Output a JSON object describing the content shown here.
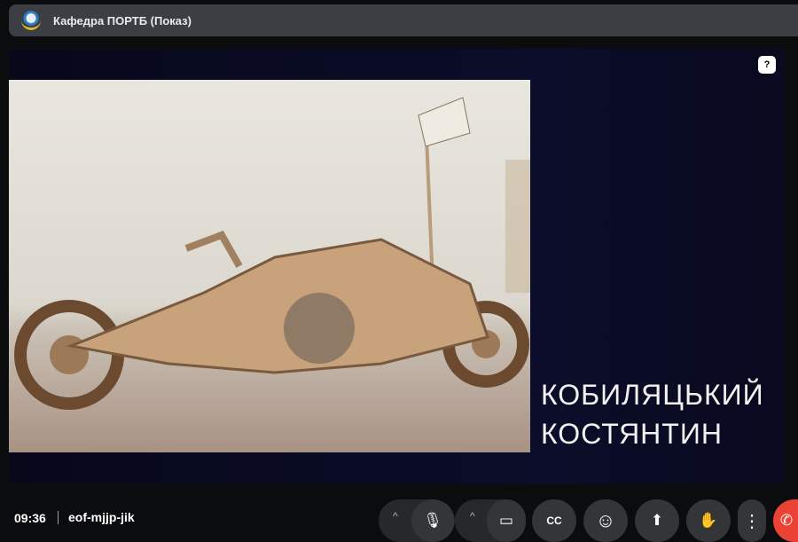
{
  "window": {
    "title": "Кафедра ПОРТБ (Показ)"
  },
  "presentation": {
    "name_line1": "КОБИЛЯЦЬКИЙ",
    "name_line2": "КОСТЯНТИН",
    "help_icon": "?"
  },
  "meeting": {
    "time": "09:36",
    "code": "eof-mjjp-jik"
  },
  "controls": {
    "chevron": "^",
    "mic": "🎙",
    "camera": "▭",
    "captions": "CC",
    "emoji": "☺",
    "present": "⬆",
    "hand": "✋",
    "more": "⋮",
    "end": "✆"
  },
  "colors": {
    "end_call": "#ea4335"
  }
}
